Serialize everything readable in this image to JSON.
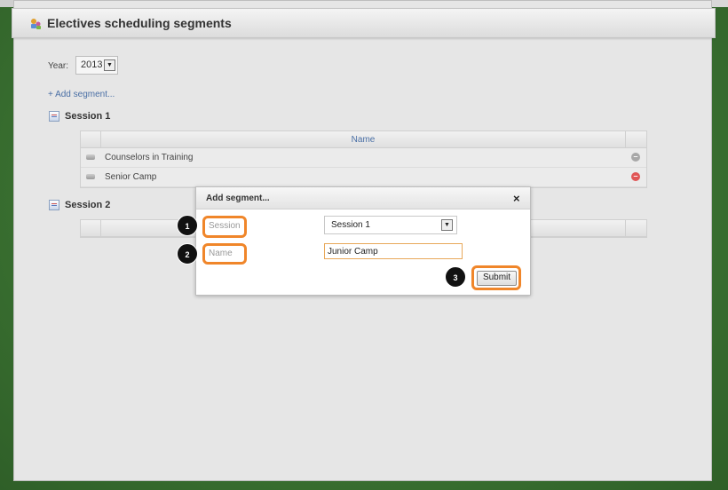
{
  "page": {
    "title": "Electives scheduling segments"
  },
  "year": {
    "label": "Year:",
    "value": "2013"
  },
  "add_segment_link": "+ Add segment...",
  "table_header": {
    "name": "Name"
  },
  "sessions": [
    {
      "title": "Session 1",
      "rows": [
        {
          "label": "Counselors in Training",
          "remove_state": "inactive"
        },
        {
          "label": "Senior Camp",
          "remove_state": "active"
        }
      ]
    },
    {
      "title": "Session 2",
      "rows": []
    }
  ],
  "dialog": {
    "title": "Add segment...",
    "close_icon": "×",
    "session_label": "Session",
    "session_value": "Session 1",
    "name_label": "Name",
    "name_value": "Junior Camp",
    "submit_label": "Submit"
  },
  "steps": [
    "1",
    "2",
    "3"
  ],
  "colors": {
    "highlight": "#f0862a",
    "link": "#4a6fa5",
    "remove_active": "#e05555"
  },
  "icons": {
    "header": "elective-segments-icon",
    "session": "calendar-icon",
    "drag": "drag-handle-icon",
    "remove": "remove-icon",
    "close": "close-icon",
    "dropdown": "chevron-down-icon"
  }
}
